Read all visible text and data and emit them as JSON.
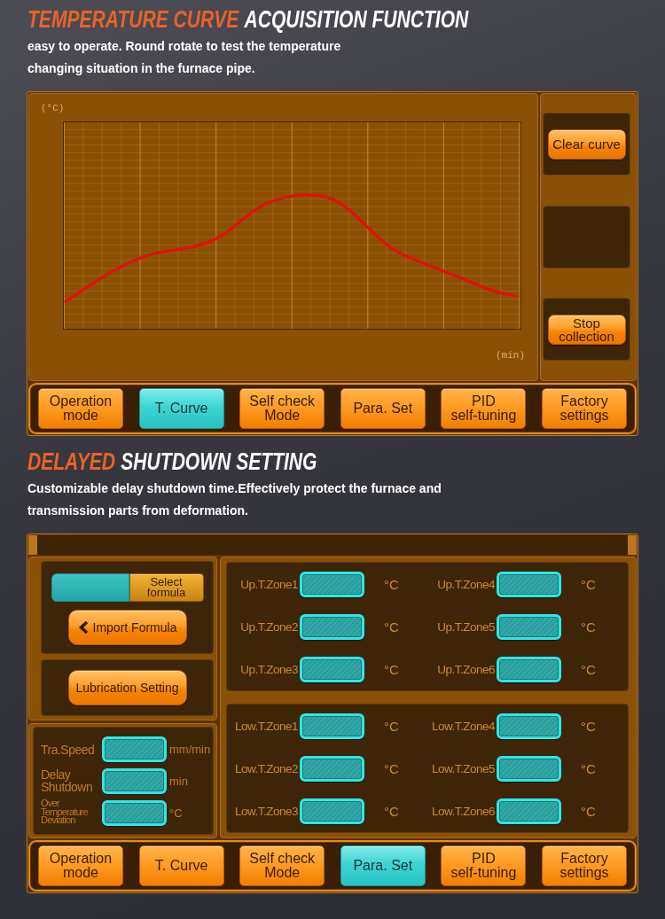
{
  "curve_section": {
    "title_accent": "TEMPERATURE CURVE",
    "title": "ACQUISITION FUNCTION",
    "description": [
      "easy to operate. Round rotate to test the temperature",
      "changing situation in the furnace pipe."
    ]
  },
  "curve_screen": {
    "y_unit": "(°C)",
    "x_unit": "(min)",
    "clear_button": "Clear curve",
    "stop_button": "Stop collection",
    "tabs": [
      {
        "label": "Operation mode",
        "selected": false
      },
      {
        "label": "T. Curve",
        "selected": true
      },
      {
        "label": "Self check Mode",
        "selected": false
      },
      {
        "label": "Para. Set",
        "selected": false
      },
      {
        "label": "PID self-tuning",
        "selected": false
      },
      {
        "label": "Factory settings",
        "selected": false
      }
    ]
  },
  "shutdown_section": {
    "title_accent": "DELAYED",
    "title": "SHUTDOWN SETTING",
    "description": [
      "Customizable delay shutdown time.Effectively protect the furnace and",
      "transmission parts from deformation."
    ]
  },
  "parameter_screen": {
    "select_formula_button": "Select formula",
    "import_formula_button": "Import Formula",
    "lubrication_button": "Lubrication Setting",
    "settings": [
      {
        "label": "Tra.Speed",
        "unit": "mm/min",
        "kind": "regular"
      },
      {
        "label": "Delay Shutdown",
        "unit": "min",
        "kind": "regular"
      },
      {
        "label": "Over Temperature Deviation",
        "unit": "°C",
        "kind": "compact"
      }
    ],
    "upper_zones": [
      {
        "label": "Up.T.Zone1",
        "unit": "°C"
      },
      {
        "label": "Up.T.Zone2",
        "unit": "°C"
      },
      {
        "label": "Up.T.Zone3",
        "unit": "°C"
      },
      {
        "label": "Up.T.Zone4",
        "unit": "°C"
      },
      {
        "label": "Up.T.Zone5",
        "unit": "°C"
      },
      {
        "label": "Up.T.Zone6",
        "unit": "°C"
      }
    ],
    "lower_zones": [
      {
        "label": "Low.T.Zone1",
        "unit": "°C"
      },
      {
        "label": "Low.T.Zone2",
        "unit": "°C"
      },
      {
        "label": "Low.T.Zone3",
        "unit": "°C"
      },
      {
        "label": "Low.T.Zone4",
        "unit": "°C"
      },
      {
        "label": "Low.T.Zone5",
        "unit": "°C"
      },
      {
        "label": "Low.T.Zone6",
        "unit": "°C"
      }
    ],
    "tabs": [
      {
        "label": "Operation mode",
        "selected": false
      },
      {
        "label": "T. Curve",
        "selected": false
      },
      {
        "label": "Self check Mode",
        "selected": false
      },
      {
        "label": "Para. Set",
        "selected": true
      },
      {
        "label": "PID self-tuning",
        "selected": false
      },
      {
        "label": "Factory settings",
        "selected": false
      }
    ]
  }
}
